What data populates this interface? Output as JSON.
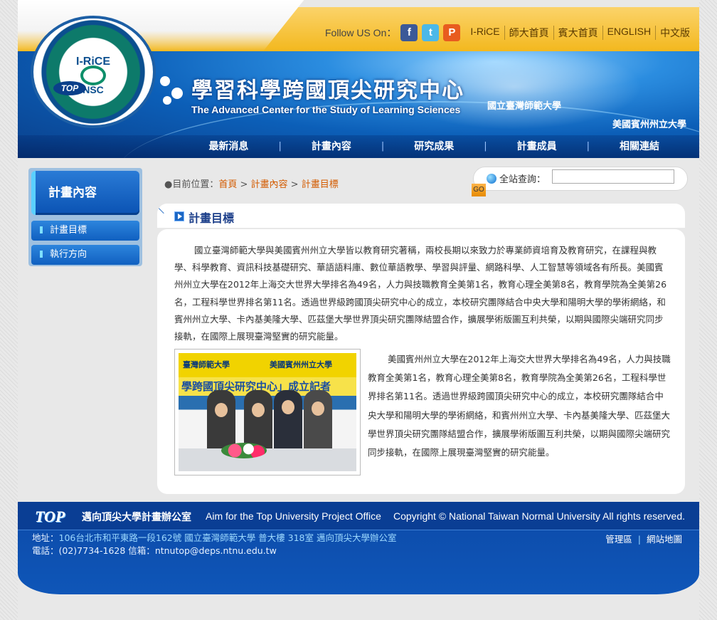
{
  "header": {
    "follow_label": "Follow US On：",
    "social": [
      "f",
      "t",
      "P"
    ],
    "top_links": [
      "I-RiCE",
      "師大首頁",
      "賓大首頁",
      "ENGLISH",
      "中文版"
    ],
    "logo_top": "I-RiCE",
    "logo_bottom": "NSC",
    "top_badge": "TOP",
    "site_title": "學習科學跨國頂尖研究中心",
    "site_subtitle": "The Advanced Center for the Study of Learning Sciences",
    "uni1": "國立臺灣師範大學",
    "uni2": "美國賓州州立大學",
    "nav": [
      "最新消息",
      "計畫內容",
      "研究成果",
      "計畫成員",
      "相關連結"
    ]
  },
  "sidebar": {
    "title": "計畫內容",
    "items": [
      "計畫目標",
      "執行方向"
    ]
  },
  "breadcrumb": {
    "prefix": "●目前位置：",
    "links": [
      "首頁",
      "計畫內容",
      "計畫目標"
    ],
    "sep": " > "
  },
  "search": {
    "label": "全站查詢：",
    "value": "",
    "go": "GO"
  },
  "content": {
    "title": "計畫目標",
    "para1": "國立臺灣師範大學與美國賓州州立大學皆以教育研究著稱，兩校長期以來致力於專業師資培育及教育研究，在課程與教學、科學教育、資訊科技基礎研究、華語語料庫、數位華語教學、學習與評量、網路科學、人工智慧等領域各有所長。美國賓州州立大學在2012年上海交大世界大學排名為49名，人力與技職教育全美第1名，教育心理全美第8名，教育學院為全美第26名，工程科學世界排名第11名。透過世界級跨國頂尖研究中心的成立，本校研究團隊結合中央大學和陽明大學的學術網絡，和賓州州立大學、卡內基美隆大學、匹茲堡大學世界頂尖研究團隊結盟合作，擴展學術版圖互利共榮，以期與國際尖端研究同步接軌，在國際上展現臺灣堅實的研究能量。",
    "para2": "美國賓州州立大學在2012年上海交大世界大學排名為49名，人力與技職教育全美第1名，教育心理全美第8名，教育學院為全美第26名，工程科學世界排名第11名。透過世界級跨國頂尖研究中心的成立，本校研究團隊結合中央大學和陽明大學的學術網絡，和賓州州立大學、卡內基美隆大學、匹茲堡大學世界頂尖研究團隊結盟合作，擴展學術版圖互利共榮，以期與國際尖端研究同步接軌，在國際上展現臺灣堅實的研究能量。",
    "photo": {
      "band_left": "臺灣師範大學",
      "band_right": "美國賓州州立大學",
      "banner": "學跨國頂尖研究中心」成立記者"
    }
  },
  "footer": {
    "logo": "TOP",
    "office_name": "邁向頂尖大學計畫辦公室",
    "office_en": "Aim for the Top University Project Office",
    "copyright": "Copyright © National Taiwan Normal University All rights reserved.",
    "address_label": "地址：",
    "address": "106台北市和平東路一段162號 國立臺灣師範大學 普大樓 318室 邁向頂尖大學辦公室",
    "phone_label": "電話：",
    "phone": "(02)7734-1628",
    "mail_label": "信箱：",
    "mail": "ntnutop@deps.ntnu.edu.tw",
    "links": [
      "管理區",
      "網站地圖"
    ]
  }
}
